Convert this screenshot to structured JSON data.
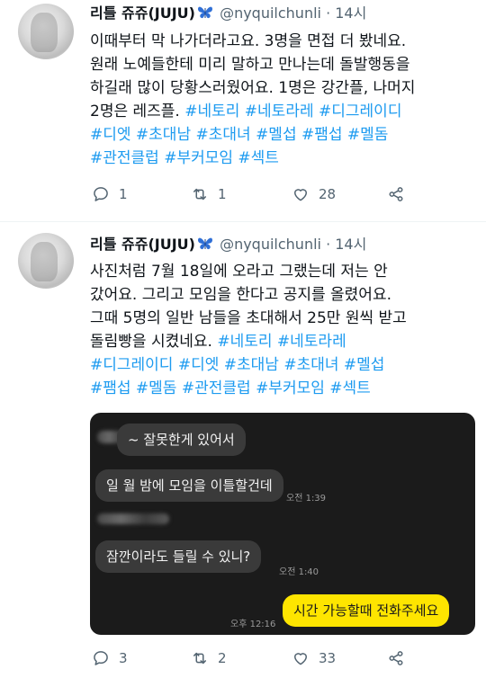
{
  "tweet1": {
    "name": "리틀 쥬쥬(JUJU)",
    "handle": "@nyquilchunli",
    "dot": "·",
    "time": "14시",
    "lines": [
      [
        {
          "t": "이때부터 막 나가더라고요. 3명을 면접 더 봤네요.",
          "tag": false
        }
      ],
      [
        {
          "t": "원래 노예들한테 미리 말하고 만나는데 돌발행동을",
          "tag": false
        }
      ],
      [
        {
          "t": "하길래 많이 당황스러웠어요. 1명은 강간플, 나머지",
          "tag": false
        }
      ],
      [
        {
          "t": "2명은 레즈플. ",
          "tag": false
        },
        {
          "t": "#네토리 #네토라레 #디그레이디",
          "tag": true
        }
      ],
      [
        {
          "t": "#디엣 #초대남 #초대녀 #멜섭 #팸섭 #멜돔",
          "tag": true
        }
      ],
      [
        {
          "t": "#관전클럽 #부커모임 #섹트",
          "tag": true
        }
      ]
    ],
    "replies": "1",
    "retweets": "1",
    "likes": "28"
  },
  "tweet2": {
    "name": "리틀 쥬쥬(JUJU)",
    "handle": "@nyquilchunli",
    "dot": "·",
    "time": "14시",
    "lines": [
      [
        {
          "t": "사진처럼 7월 18일에 오라고 그랬는데 저는 안",
          "tag": false
        }
      ],
      [
        {
          "t": "갔어요. 그리고 모임을 한다고 공지를 올렸어요.",
          "tag": false
        }
      ],
      [
        {
          "t": "그때 5명의 일반 남들을 초대해서 25만 원씩 받고",
          "tag": false
        }
      ],
      [
        {
          "t": "돌림빵을 시켰네요. ",
          "tag": false
        },
        {
          "t": "#네토리 #네토라레",
          "tag": true
        }
      ],
      [
        {
          "t": "#디그레이디 #디엣 #초대남 #초대녀 #멜섭",
          "tag": true
        }
      ],
      [
        {
          "t": "#팸섭 #멜돔 #관전클럽 #부커모임 #섹트",
          "tag": true
        }
      ]
    ],
    "chat": {
      "msg1": "~ 잘못한게 있어서",
      "msg2": "일 월 밤에 모임을 이틀할건데",
      "time1": "오전 1:39",
      "msg3": "잠깐이라도 들릴 수 있니?",
      "time2": "오전 1:40",
      "reply": "시간 가능할때 전화주세요",
      "time3": "오후 12:16"
    },
    "replies": "3",
    "retweets": "2",
    "likes": "33"
  },
  "colors": {
    "hashtag": "#1d9bf0",
    "secondary": "#536471",
    "chat_bg": "#1b1b1b",
    "chat_bubble_in": "#3a3a3a",
    "chat_bubble_out": "#fee500"
  },
  "icons": [
    "butterfly-emoji-icon",
    "reply-icon",
    "retweet-icon",
    "like-icon",
    "share-icon"
  ]
}
